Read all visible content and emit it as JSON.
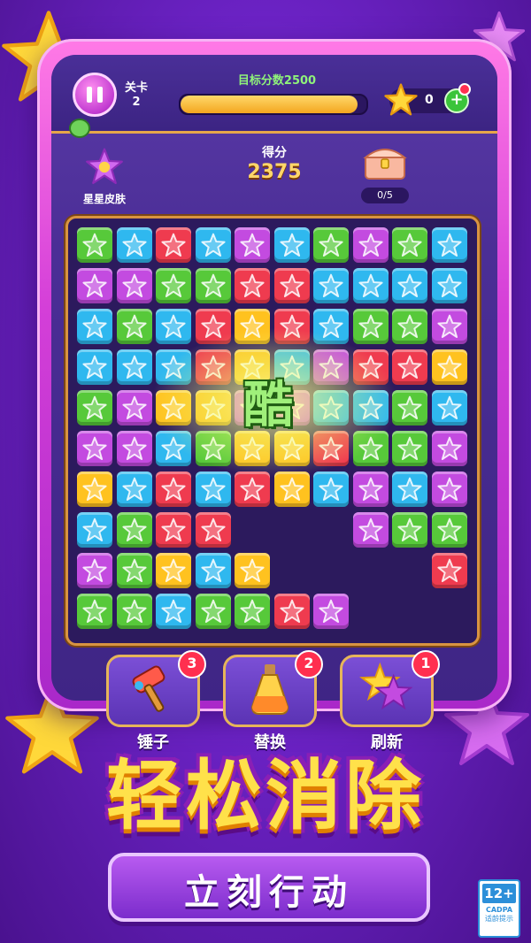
{
  "hud": {
    "level_label": "关卡",
    "level": "2",
    "target_label": "目标分数2500",
    "progress": 0.95,
    "star_count": "0",
    "plus": "+",
    "score_label": "得分",
    "score": "2375",
    "skin_label": "星星皮肤",
    "chest_progress": "0/5"
  },
  "combo_text": "酷",
  "board": {
    "rows": [
      [
        "green",
        "cyan",
        "red",
        "cyan",
        "purple",
        "cyan",
        "green",
        "purple",
        "green",
        "cyan"
      ],
      [
        "purple",
        "purple",
        "green",
        "green",
        "red",
        "red",
        "cyan",
        "cyan",
        "cyan",
        "cyan"
      ],
      [
        "cyan",
        "green",
        "cyan",
        "red",
        "yellow",
        "red",
        "cyan",
        "green",
        "green",
        "purple"
      ],
      [
        "cyan",
        "cyan",
        "cyan",
        "red",
        "yellow",
        "cyan",
        "purple",
        "red",
        "red",
        "yellow"
      ],
      [
        "green",
        "purple",
        "yellow",
        "yellow",
        "purple",
        "purple",
        "cyan",
        "cyan",
        "green",
        "cyan"
      ],
      [
        "purple",
        "purple",
        "cyan",
        "green",
        "yellow",
        "yellow",
        "red",
        "green",
        "green",
        "purple"
      ],
      [
        "yellow",
        "cyan",
        "red",
        "cyan",
        "red",
        "yellow",
        "cyan",
        "purple",
        "cyan",
        "purple"
      ],
      [
        "cyan",
        "green",
        "red",
        "red",
        "",
        "",
        "",
        "purple",
        "green",
        "green"
      ],
      [
        "purple",
        "green",
        "yellow",
        "cyan",
        "yellow",
        "",
        "",
        "",
        "",
        "red"
      ],
      [
        "green",
        "green",
        "cyan",
        "green",
        "green",
        "red",
        "purple",
        "",
        "",
        ""
      ]
    ]
  },
  "tools": [
    {
      "name": "锤子",
      "count": "3",
      "icon": "hammer-icon"
    },
    {
      "name": "替换",
      "count": "2",
      "icon": "potion-icon"
    },
    {
      "name": "刷新",
      "count": "1",
      "icon": "refresh-star-icon"
    }
  ],
  "banner": {
    "headline": "轻松消除",
    "subtitle": "立刻行动"
  },
  "age_rating": {
    "value": "12+",
    "org": "CADPA",
    "note": "适龄提示"
  },
  "colors": {
    "green": "#57c93a",
    "cyan": "#2fb8ef",
    "red": "#ef3b4f",
    "purple": "#c34be0",
    "yellow": "#ffc21f"
  }
}
